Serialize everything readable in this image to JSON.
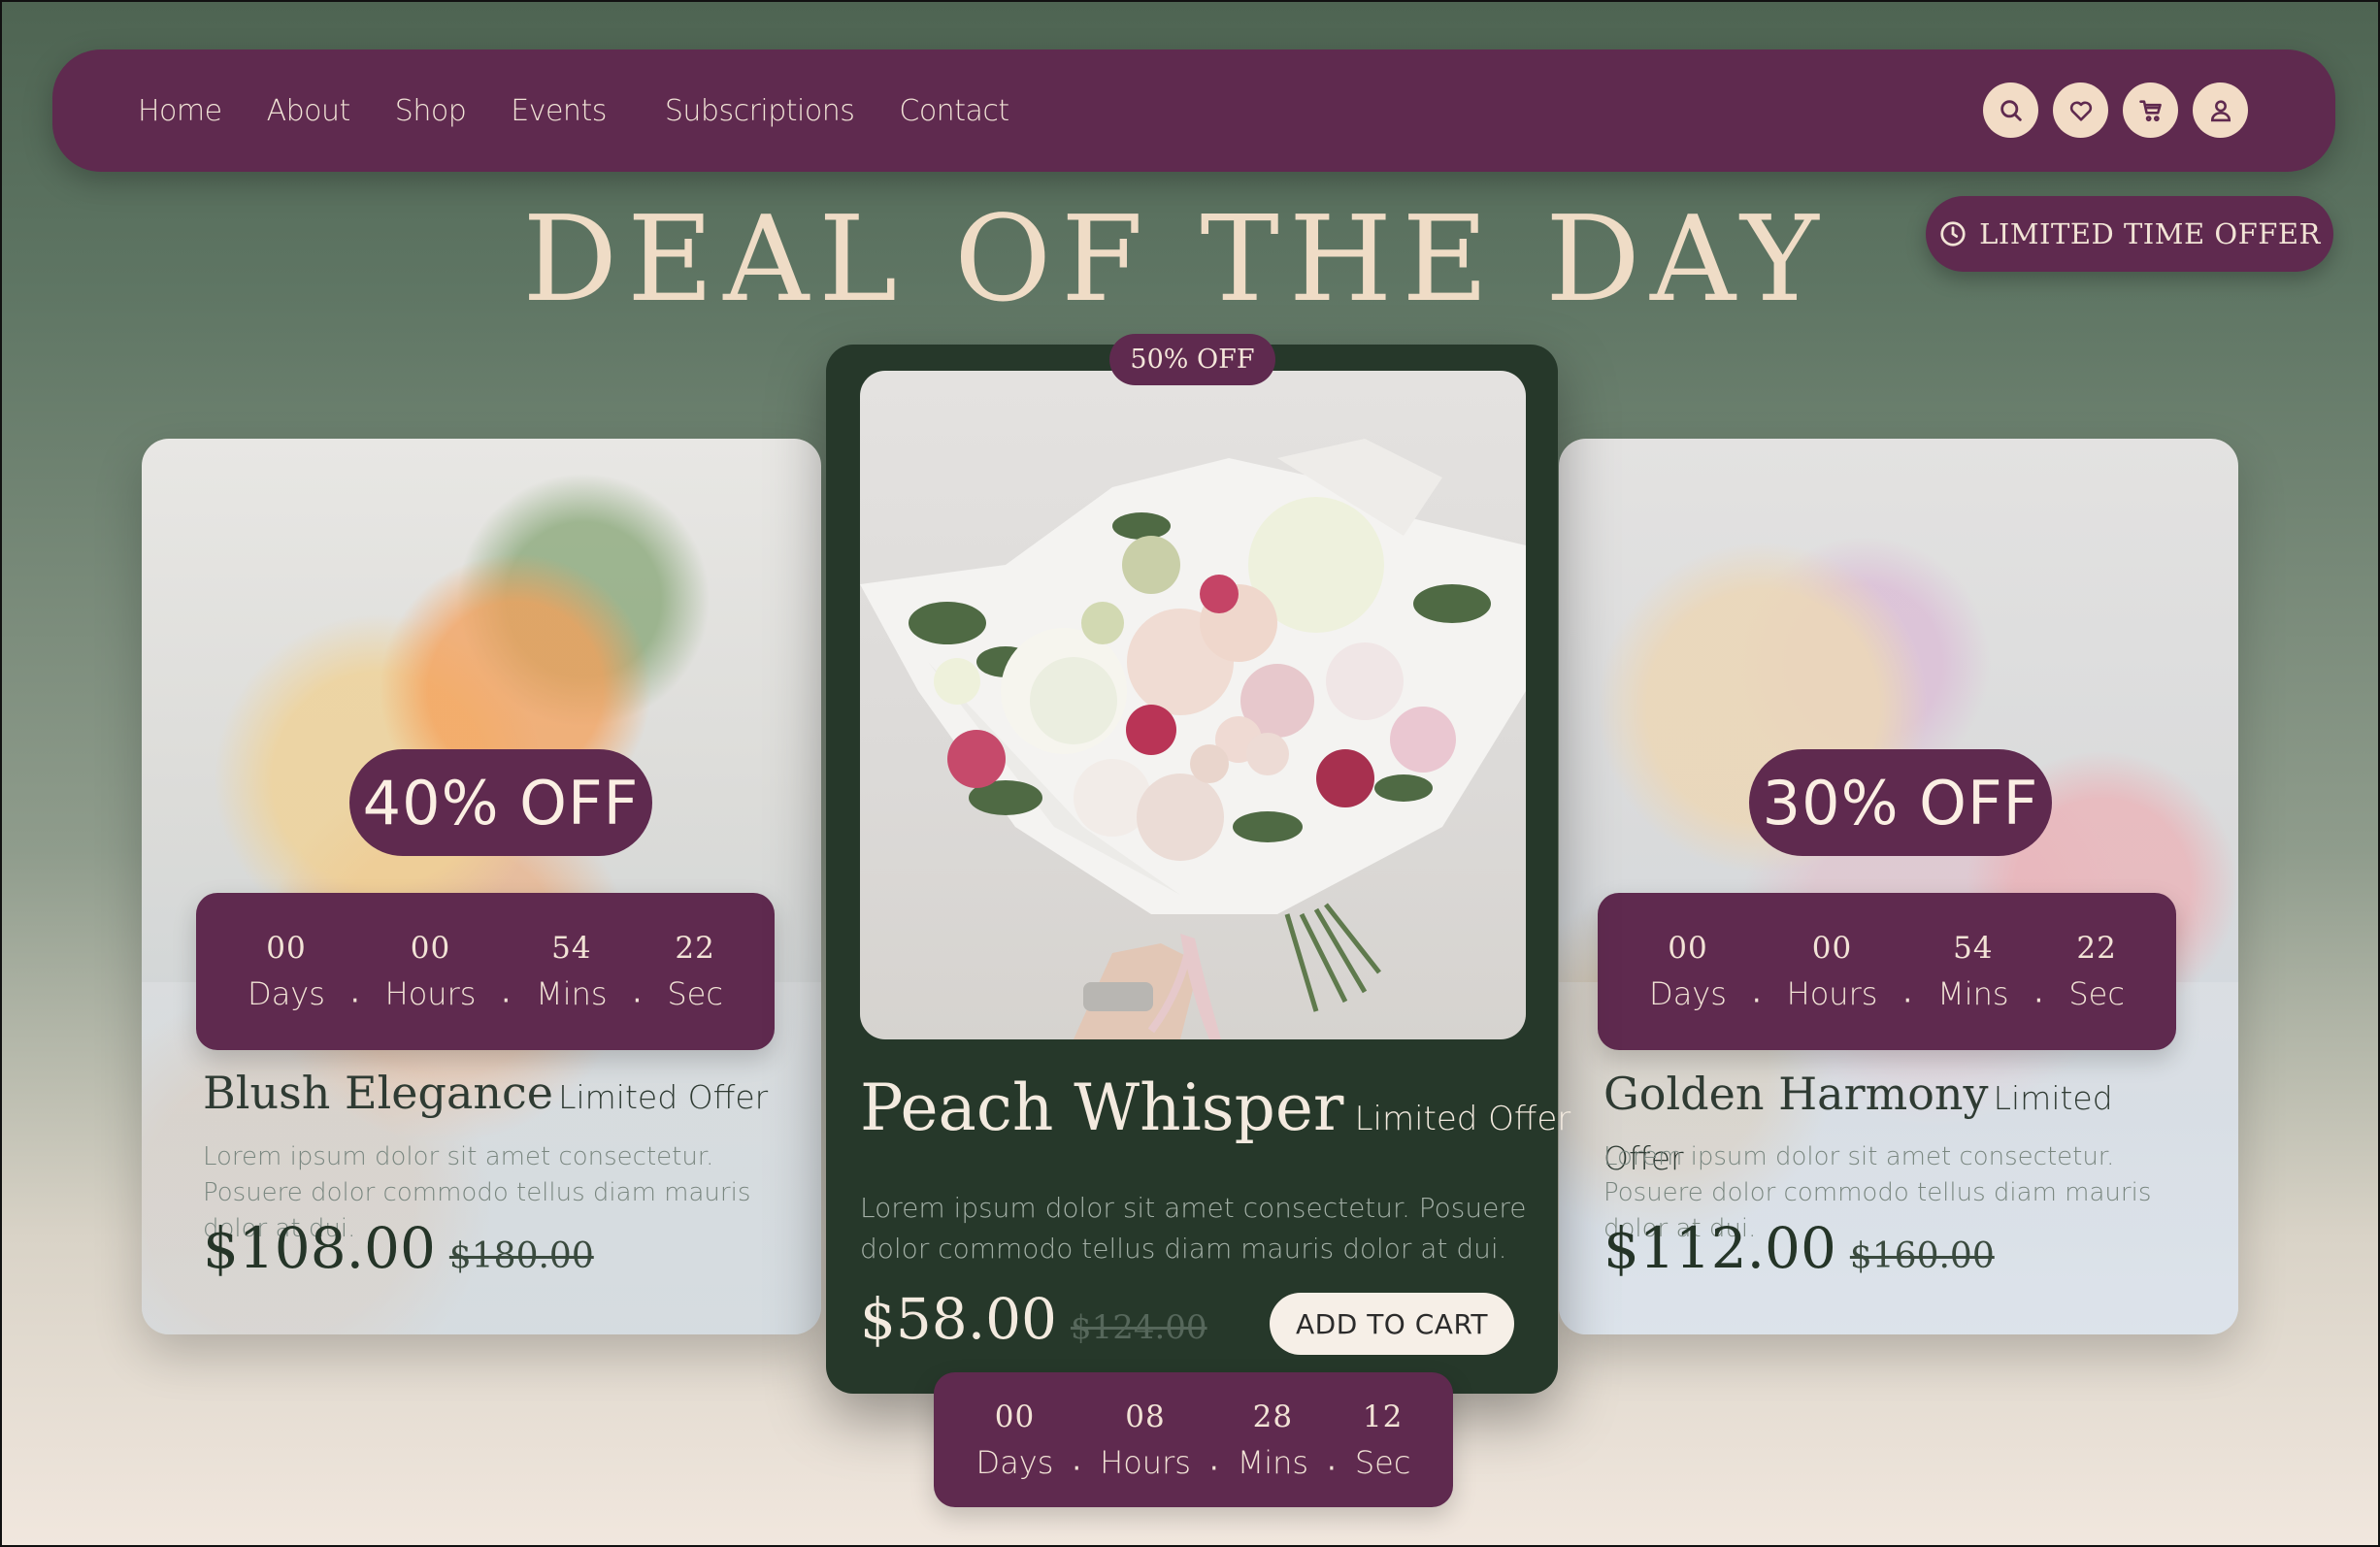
{
  "nav": {
    "links": [
      "Home",
      "About",
      "Shop",
      "Events",
      "Subscriptions",
      "Contact"
    ],
    "icons": [
      "search-icon",
      "heart-icon",
      "cart-icon",
      "user-icon"
    ],
    "colors": {
      "bar": "#5f2a4f",
      "icon_bg": "#f2dcc6"
    }
  },
  "title": "DEAL OF THE DAY",
  "limited_badge": "LIMITED TIME OFFER",
  "countdown_labels": {
    "days": "Days",
    "hours": "Hours",
    "mins": "Mins",
    "sec": "Sec"
  },
  "cards": {
    "left": {
      "discount": "40% OFF",
      "countdown": {
        "days": "00",
        "hours": "00",
        "mins": "54",
        "sec": "22"
      },
      "name": "Blush Elegance",
      "tag": "Limited Offer",
      "description": "Lorem ipsum dolor sit amet consectetur. Posuere dolor commodo tellus diam mauris dolor at dui.",
      "price": "$108.00",
      "old_price": "$180.00"
    },
    "center": {
      "discount": "50% OFF",
      "countdown": {
        "days": "00",
        "hours": "08",
        "mins": "28",
        "sec": "12"
      },
      "name": "Peach Whisper",
      "tag": "Limited Offer",
      "description": "Lorem ipsum dolor sit amet consectetur. Posuere dolor commodo tellus diam mauris dolor at dui.",
      "price": "$58.00",
      "old_price": "$124.00",
      "cta": "ADD TO CART"
    },
    "right": {
      "discount": "30% OFF",
      "countdown": {
        "days": "00",
        "hours": "00",
        "mins": "54",
        "sec": "22"
      },
      "name": "Golden Harmony",
      "tag": "Limited Offer",
      "description": "Lorem ipsum dolor sit amet consectetur. Posuere dolor commodo tellus diam mauris dolor at dui.",
      "price": "$112.00",
      "old_price": "$160.00"
    }
  }
}
